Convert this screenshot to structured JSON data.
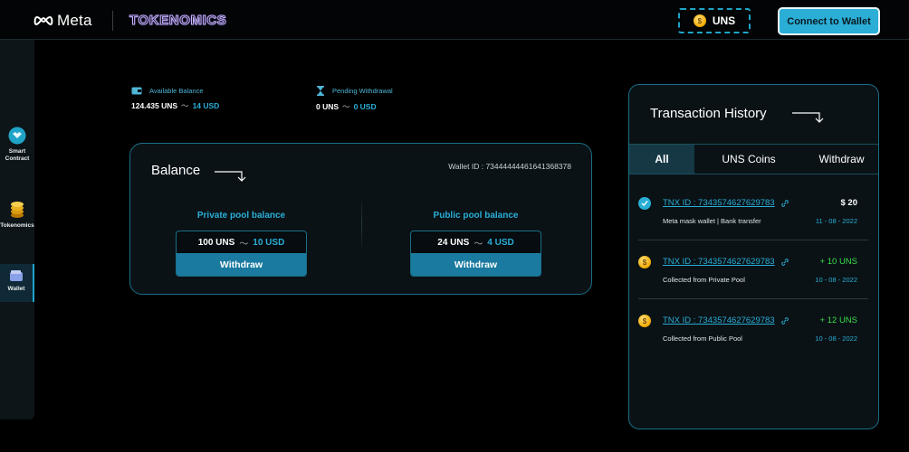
{
  "header": {
    "brand": "Meta",
    "app_name": "TOKENOMICS",
    "currency_chip": "UNS",
    "connect_label": "Connect to Wallet",
    "coin_symbol": "$"
  },
  "sidebar": {
    "items": [
      {
        "label_line1": "Smart",
        "label_line2": "Contract"
      },
      {
        "label_line1": "Tokenomics",
        "label_line2": ""
      },
      {
        "label_line1": "Wallet",
        "label_line2": ""
      }
    ]
  },
  "stats": {
    "available": {
      "title": "Available Balance",
      "amount": "124.435 UNS",
      "usd": "14 USD"
    },
    "pending": {
      "title": "Pending Withdrawal",
      "amount": "0 UNS",
      "usd": "0 USD"
    }
  },
  "balance": {
    "title": "Balance",
    "wallet_id": "Wallet ID : 73444444461641368378",
    "private": {
      "title": "Private pool balance",
      "amount": "100 UNS",
      "usd": "10 USD",
      "button": "Withdraw"
    },
    "public": {
      "title": "Public pool balance",
      "amount": "24 UNS",
      "usd": "4 USD",
      "button": "Withdraw"
    }
  },
  "transactions": {
    "title": "Transaction History",
    "tabs": [
      "All",
      "UNS Coins",
      "Withdraw"
    ],
    "items": [
      {
        "id": "TNX ID : 7343574627629783",
        "amount": "$ 20",
        "desc": "Meta mask wallet  |  Bank transfer",
        "date": "11 - 08 - 2022",
        "icon": "check-icon"
      },
      {
        "id": "TNX ID : 7343574627629783",
        "amount": "+ 10 UNS",
        "desc": "Collected from Private Pool",
        "date": "10 - 08 - 2022",
        "icon": "coin-icon"
      },
      {
        "id": "TNX ID : 7343574627629783",
        "amount": "+ 12 UNS",
        "desc": "Collected from Public Pool",
        "date": "10 - 08 - 2022",
        "icon": "coin-icon"
      }
    ]
  },
  "colors": {
    "accent": "#2aaed6",
    "positive": "#3adf4a",
    "card_border": "#1b6e86",
    "button": "#1a7aa0"
  }
}
